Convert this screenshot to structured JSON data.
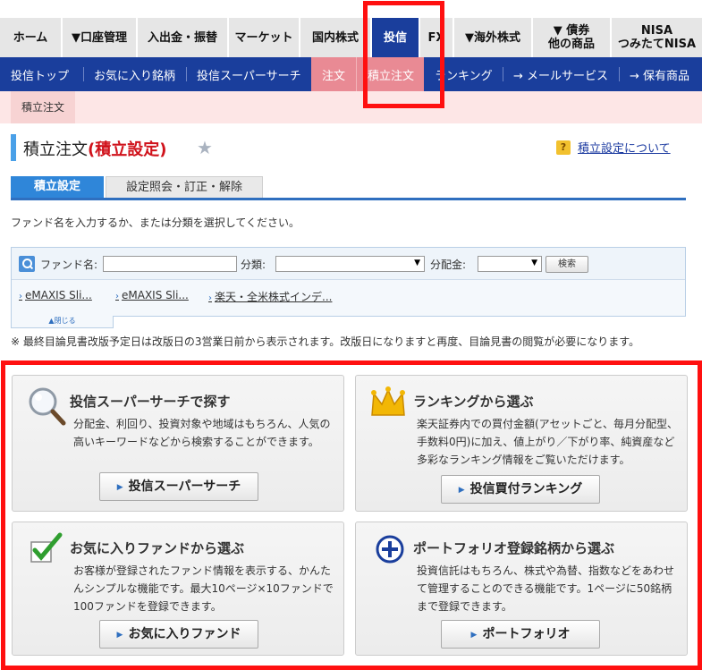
{
  "topnav": {
    "items": [
      {
        "label": "ホーム"
      },
      {
        "label": "▼口座管理"
      },
      {
        "label": "入出金・振替"
      },
      {
        "label": "マーケット"
      },
      {
        "label": "国内株式"
      },
      {
        "label": "投信"
      },
      {
        "label": "FX"
      },
      {
        "label": "▼海外株式"
      },
      {
        "label": "▼ 債券\n他の商品"
      },
      {
        "label": "NISA\nつみたてNISA"
      }
    ],
    "active_index": 5
  },
  "subnav": {
    "items": [
      {
        "label": "投信トップ"
      },
      {
        "label": "お気に入り銘柄"
      },
      {
        "label": "投信スーパーサーチ"
      },
      {
        "label": "注文"
      },
      {
        "label": "積立注文"
      },
      {
        "label": "ランキング"
      },
      {
        "label": "→ メールサービス"
      },
      {
        "label": "→ 保有商品"
      }
    ]
  },
  "breadcrumb": {
    "label": "積立注文"
  },
  "page": {
    "title": "積立注文",
    "title_paren": "(積立設定)",
    "help_link": "積立設定について",
    "help_icon": "?"
  },
  "tabs": [
    {
      "label": "積立設定"
    },
    {
      "label": "設定照会・訂正・解除"
    }
  ],
  "instruction": "ファンド名を入力するか、または分類を選択してください。",
  "search": {
    "fund_label": "ファンド名:",
    "fund_value": "",
    "category_label": "分類:",
    "category_value": "",
    "dividend_label": "分配金:",
    "dividend_value": "",
    "button": "検索",
    "quicklinks": [
      "eMAXIS Sli...",
      "eMAXIS Sli...",
      "楽天・全米株式インデ..."
    ],
    "close_label": "▲閉じる"
  },
  "note": "※ 最終目論見書改版予定日は改版日の3営業日前から表示されます。改版日になりますと再度、目論見書の閲覧が必要になります。",
  "cards": [
    {
      "icon": "magnifier-icon",
      "title": "投信スーパーサーチで探す",
      "desc": "分配金、利回り、投資対象や地域はもちろん、人気の高いキーワードなどから検索することができます。",
      "button": "投信スーパーサーチ"
    },
    {
      "icon": "crown-icon",
      "title": "ランキングから選ぶ",
      "desc": "楽天証券内での買付金額(アセットごと、毎月分配型、手数料0円)に加え、値上がり／下がり率、純資産など多彩なランキング情報をご覧いただけます。",
      "button": "投信買付ランキング"
    },
    {
      "icon": "checkmark-icon",
      "title": "お気に入りファンドから選ぶ",
      "desc": "お客様が登録されたファンド情報を表示する、かんたんシンプルな機能です。最大10ページ×10ファンドで100ファンドを登録できます。",
      "button": "お気に入りファンド"
    },
    {
      "icon": "plus-icon",
      "title": "ポートフォリオ登録銘柄から選ぶ",
      "desc": "投資信託はもちろん、株式や為替、指数などをあわせて管理することのできる機能です。1ページに50銘柄まで登録できます。",
      "button": "ポートフォリオ"
    }
  ],
  "colors": {
    "nav_active": "#1a3e9c",
    "highlight_frame": "#ff1010",
    "subnav_pink": "#e98a94"
  }
}
